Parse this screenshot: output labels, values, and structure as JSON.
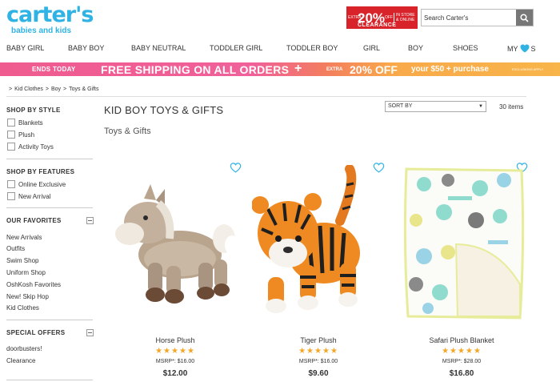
{
  "brand": {
    "name": "carter's",
    "tagline": "babies and kids"
  },
  "promo": {
    "extra": "EXTRA",
    "percent": "20%",
    "off": "OFF",
    "right": "IN STORE & ONLINE",
    "clearance": "CLEARANCE"
  },
  "search": {
    "value": "Search Carter's"
  },
  "nav": {
    "items": [
      "BABY GIRL",
      "BABY BOY",
      "BABY NEUTRAL",
      "TODDLER GIRL",
      "TODDLER BOY",
      "GIRL",
      "BOY",
      "SHOES"
    ],
    "my_pre": "MY",
    "my_post": "S"
  },
  "banner": {
    "ends": "ENDS TODAY",
    "main": "FREE SHIPPING ON ALL ORDERS",
    "plus": "+",
    "extra": "EXTRA",
    "pct": "20% OFF",
    "purchase": "your $50 + purchase",
    "exclusions": "EXCLUSIONS APPLY"
  },
  "breadcrumb": [
    "Kid Clothes",
    "Boy",
    "Toys & Gifts"
  ],
  "sidebar": {
    "style_heading": "SHOP BY STYLE",
    "style_items": [
      "Blankets",
      "Plush",
      "Activity Toys"
    ],
    "features_heading": "SHOP BY FEATURES",
    "features_items": [
      "Online Exclusive",
      "New Arrival"
    ],
    "favorites_heading": "OUR FAVORITES",
    "favorites_items": [
      "New Arrivals",
      "Outfits",
      "Swim Shop",
      "Uniform Shop",
      "OshKosh Favorites",
      "New! Skip Hop",
      "Kid Clothes"
    ],
    "offers_heading": "SPECIAL OFFERS",
    "offers_items": [
      "doorbusters!",
      "Clearance"
    ]
  },
  "content": {
    "title": "KID BOY TOYS & GIFTS",
    "subtitle": "Toys & Gifts",
    "sort_label": "SORT BY",
    "count": "30 items"
  },
  "products": [
    {
      "name": "Horse Plush",
      "stars": "★★★★★",
      "msrp": "MSRP*: $16.00",
      "price": "$12.00"
    },
    {
      "name": "Tiger Plush",
      "stars": "★★★★★",
      "msrp": "MSRP*: $16.00",
      "price": "$9.60"
    },
    {
      "name": "Safari Plush Blanket",
      "stars": "★★★★★",
      "msrp": "MSRP*: $28.00",
      "price": "$16.80"
    }
  ],
  "colors": {
    "brand": "#2fb3e4",
    "promo_red": "#d8232a",
    "stars": "#f5a623",
    "banner_pink": "#ef5b8e",
    "banner_orange": "#f8b54a"
  }
}
